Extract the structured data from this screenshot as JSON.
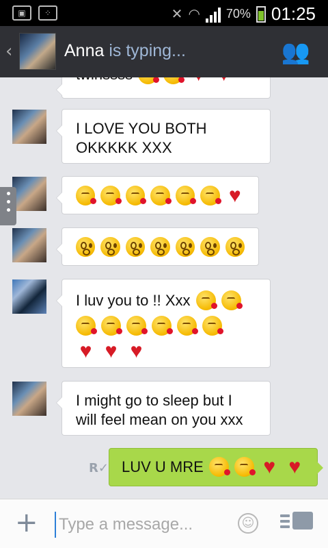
{
  "status": {
    "battery": "70%",
    "time": "01:25"
  },
  "header": {
    "name": "Anna",
    "status": "is typing..."
  },
  "messages": [
    {
      "text": "twinssss"
    },
    {
      "line1": "I LOVE YOU BOTH",
      "line2": "OKKKKK XXX"
    },
    {
      "text": "I luv you to !! Xxx"
    },
    {
      "line1": "I might go to sleep but I",
      "line2": "will feel mean on you xxx"
    },
    {
      "text": "LUV U MRE"
    }
  ],
  "input": {
    "placeholder": "Type a message..."
  },
  "icons": [
    "image-icon",
    "bbm-icon",
    "mute-icon",
    "wifi-icon",
    "signal-icon",
    "battery-icon",
    "back-icon",
    "group-icon",
    "kiss-emoji",
    "flushed-emoji",
    "heart-emoji",
    "read-receipt-icon",
    "plus-icon",
    "smiley-icon",
    "send-icon"
  ],
  "colors": {
    "outgoing_bubble": "#a8d84a",
    "incoming_bubble": "#ffffff",
    "header_bg": "#2f3035",
    "typing_text": "#9fb7d6"
  }
}
